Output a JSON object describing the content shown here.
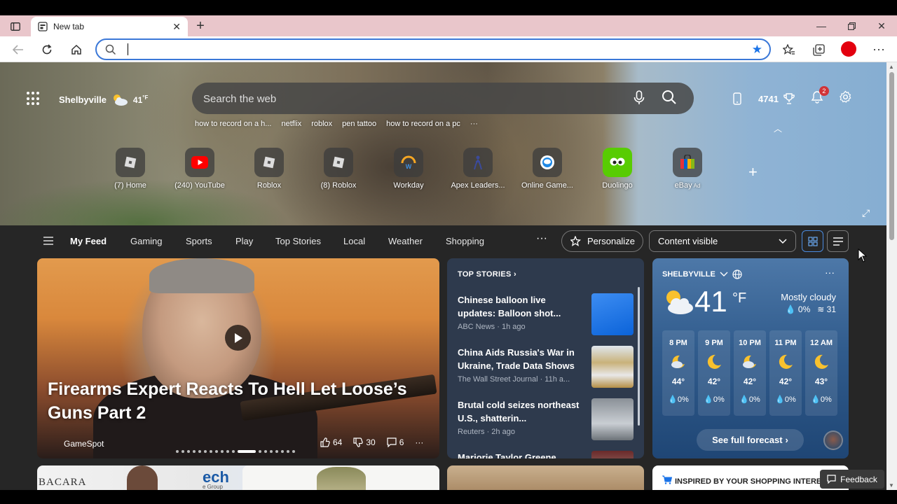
{
  "browser": {
    "tab_title": "New tab",
    "address_value": "",
    "colors": {
      "tabbar": "#e9c6cb",
      "accent": "#1a73e8",
      "profile": "#e3000f"
    }
  },
  "header": {
    "location": "Shelbyville",
    "temp": "41",
    "temp_unit": "°F",
    "search_placeholder": "Search the web",
    "trending": [
      "how to record on a h...",
      "netflix",
      "roblox",
      "pen tattoo",
      "how to record on a pc",
      "···"
    ],
    "points": "4741",
    "notifications": "2"
  },
  "quicklinks": [
    {
      "label": "(7) Home",
      "icon": "roblox-icon"
    },
    {
      "label": "(240) YouTube",
      "icon": "youtube-icon"
    },
    {
      "label": "Roblox",
      "icon": "roblox-icon"
    },
    {
      "label": "(8) Roblox",
      "icon": "roblox-icon"
    },
    {
      "label": "Workday",
      "icon": "workday-icon"
    },
    {
      "label": "Apex Leaders...",
      "icon": "apex-icon"
    },
    {
      "label": "Online Game...",
      "icon": "online-game-icon"
    },
    {
      "label": "Duolingo",
      "icon": "duolingo-icon"
    },
    {
      "label": "eBay",
      "ad": "Ad",
      "icon": "ebay-icon"
    }
  ],
  "feednav": {
    "items": [
      "My Feed",
      "Gaming",
      "Sports",
      "Play",
      "Top Stories",
      "Local",
      "Weather",
      "Shopping"
    ],
    "more": "···",
    "personalize": "Personalize",
    "content_visible": "Content visible"
  },
  "hero_card": {
    "title": "Firearms Expert Reacts To Hell Let Loose’s Guns Part 2",
    "source": "GameSpot",
    "likes": "64",
    "dislikes": "30",
    "comments": "6",
    "more": "···",
    "carousel_total": 19,
    "carousel_active": 11
  },
  "top_stories": {
    "heading": "TOP STORIES",
    "items": [
      {
        "title": "Chinese balloon live updates: Balloon shot...",
        "meta": "ABC News · 1h ago"
      },
      {
        "title": "China Aids Russia's War in Ukraine, Trade Data Shows",
        "meta": "The Wall Street Journal · 11h a..."
      },
      {
        "title": "Brutal cold seizes northeast U.S., shatterin...",
        "meta": "Reuters · 2h ago"
      },
      {
        "title": "Marjorie Taylor Greene",
        "meta": ""
      }
    ]
  },
  "weather": {
    "location": "SHELBYVILLE",
    "temp": "41",
    "unit": "°F",
    "condition": "Mostly cloudy",
    "precip": "0%",
    "aqi": "31",
    "hourly": [
      {
        "time": "8 PM",
        "temp": "44°",
        "precip": "0%",
        "icon": "cloudy-night-icon"
      },
      {
        "time": "9 PM",
        "temp": "42°",
        "precip": "0%",
        "icon": "moon-icon"
      },
      {
        "time": "10 PM",
        "temp": "42°",
        "precip": "0%",
        "icon": "cloudy-night-icon"
      },
      {
        "time": "11 PM",
        "temp": "42°",
        "precip": "0%",
        "icon": "moon-icon"
      },
      {
        "time": "12 AM",
        "temp": "43°",
        "precip": "0%",
        "icon": "moon-icon"
      }
    ],
    "see_forecast": "See full forecast"
  },
  "bottom": {
    "card1_text": "BACARA",
    "card1_logo": "ech",
    "card1_sub": "e Group",
    "card4_text": "INSPIRED BY YOUR SHOPPING INTERESTS",
    "feedback": "Feedback"
  }
}
